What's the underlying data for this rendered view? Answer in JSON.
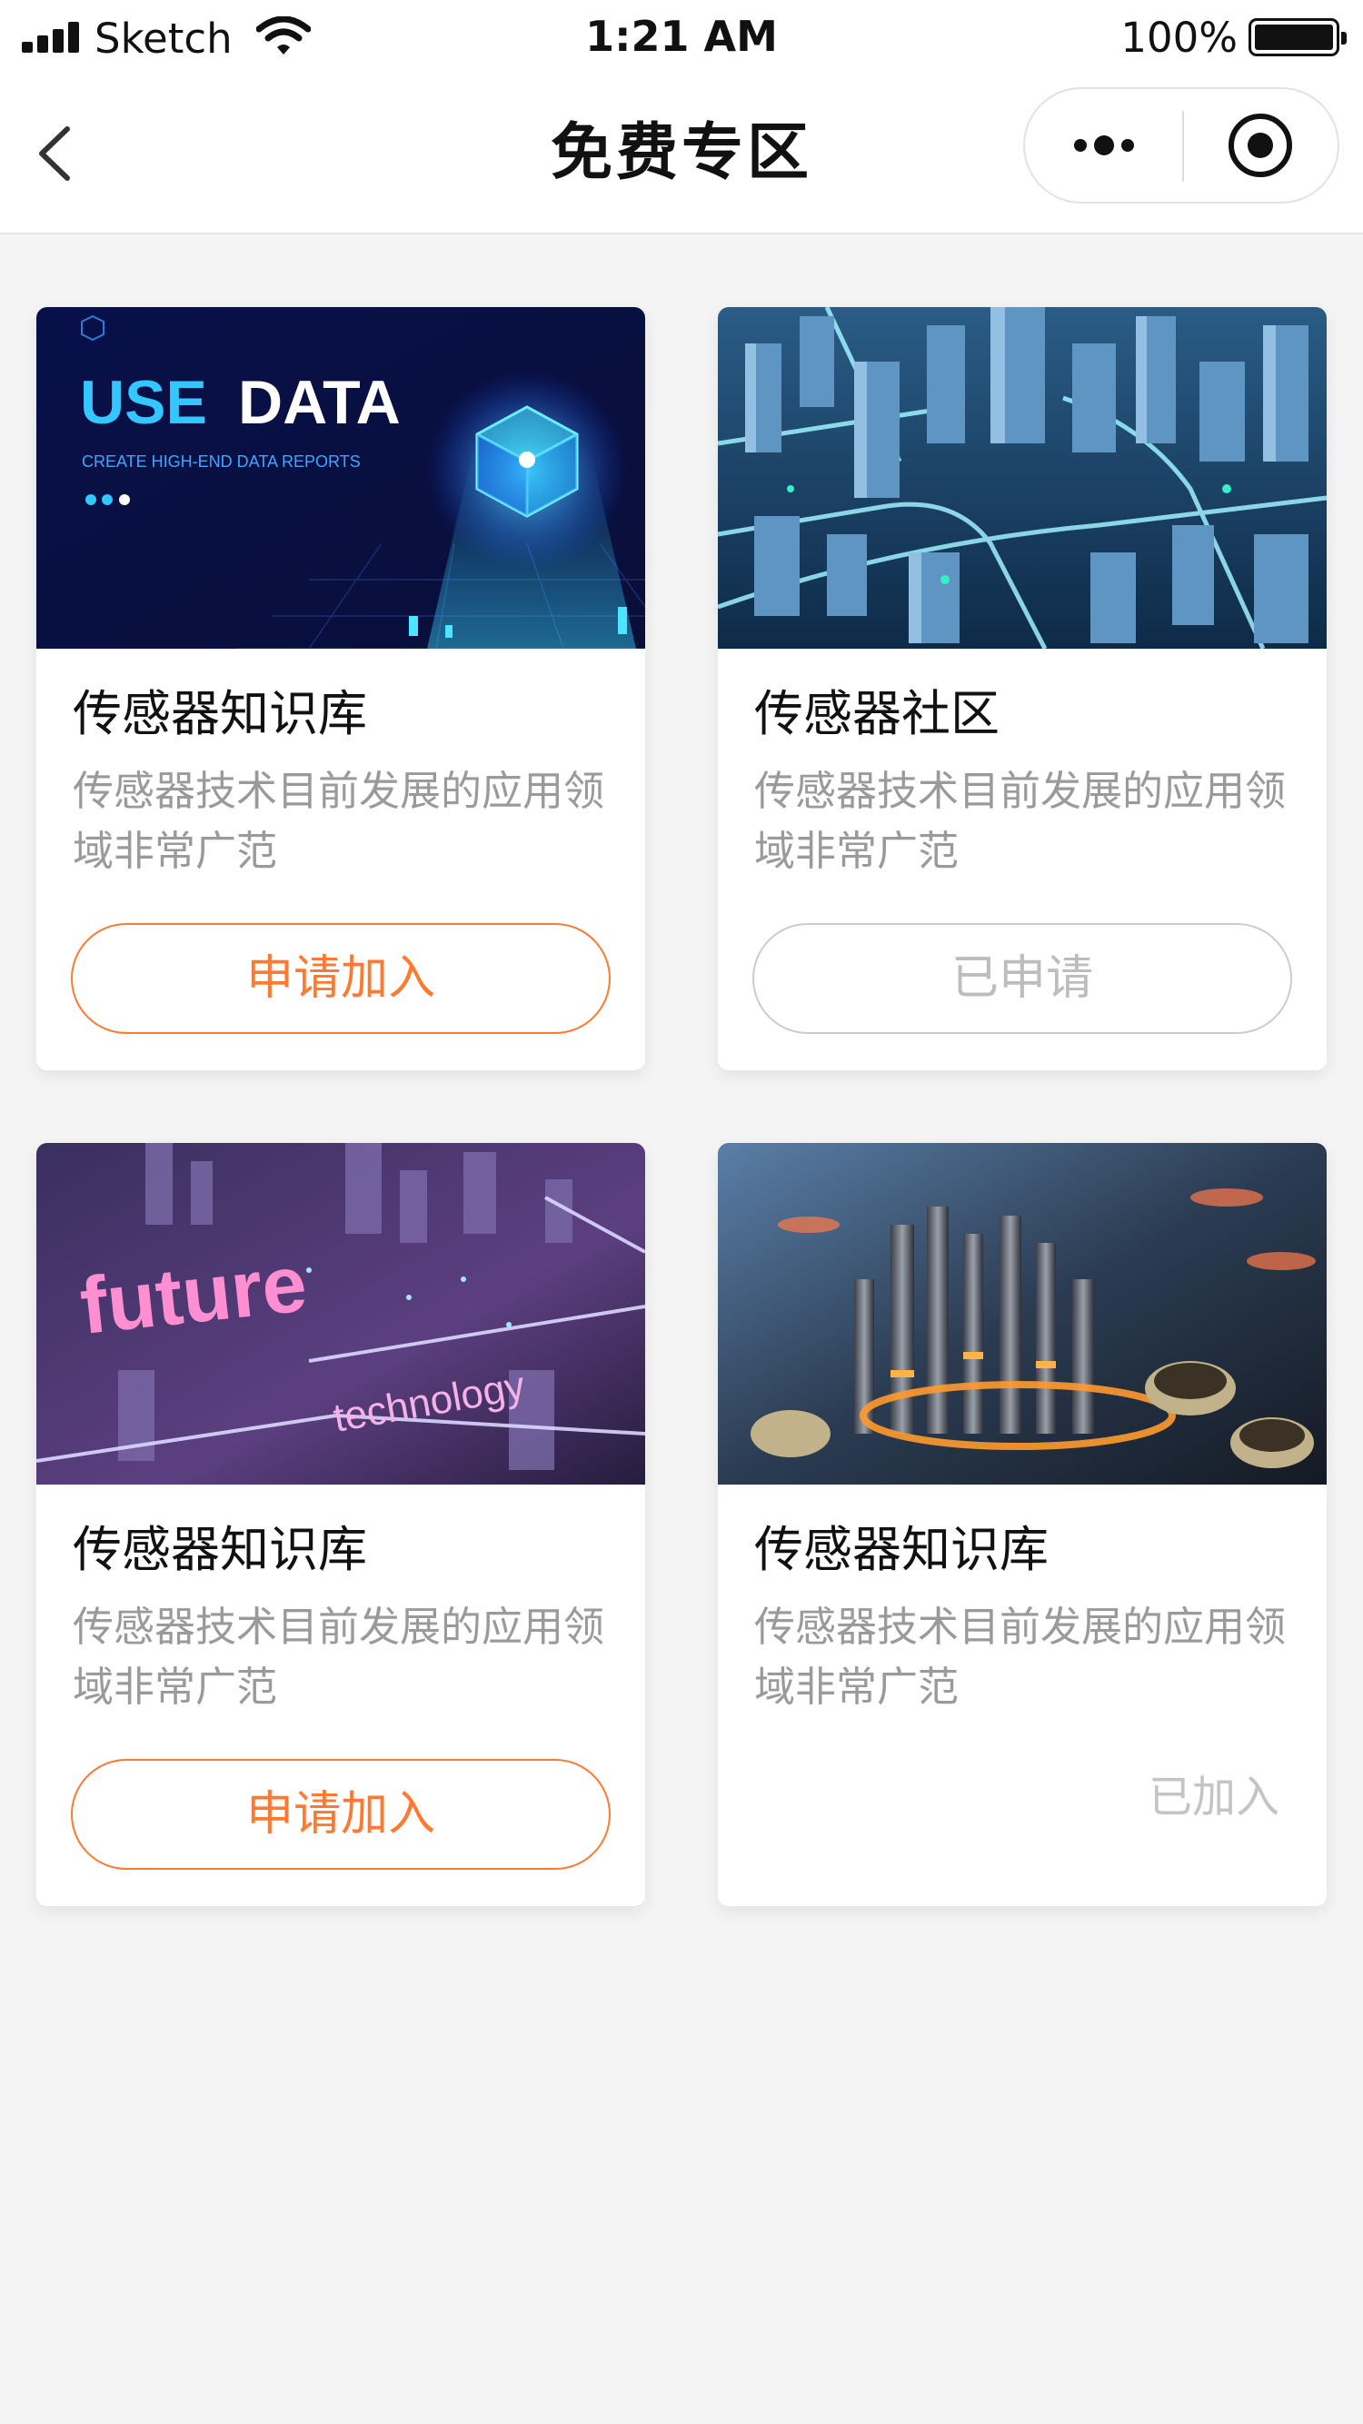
{
  "status_bar": {
    "carrier": "Sketch",
    "time": "1:21 AM",
    "battery": "100%",
    "battery_level": 1.0
  },
  "nav": {
    "title": "免费专区",
    "icons": [
      "back-arrow-icon",
      "more-dots-icon",
      "close-target-icon"
    ]
  },
  "colors": {
    "accent": "#ff7a30",
    "muted": "#bdbdbd",
    "background": "#f4f4f4"
  },
  "cards": [
    {
      "image": "use-data-banner",
      "image_text": {
        "headline_a": "USE",
        "headline_b": "DATA",
        "sub": "CREATE HIGH-END DATA REPORTS"
      },
      "title": "传感器知识库",
      "desc": "传感器技术目前发展的应用领域非常广范",
      "action_label": "申请加入",
      "action_state": "apply"
    },
    {
      "image": "blue-city-banner",
      "title": "传感器社区",
      "desc": "传感器技术目前发展的应用领域非常广范",
      "action_label": "已申请",
      "action_state": "applied"
    },
    {
      "image": "future-technology-banner",
      "image_text": {
        "word_a": "future",
        "word_b": "technology"
      },
      "title": "传感器知识库",
      "desc": "传感器技术目前发展的应用领域非常广范",
      "action_label": "申请加入",
      "action_state": "apply"
    },
    {
      "image": "circuit-chips-banner",
      "title": "传感器知识库",
      "desc": "传感器技术目前发展的应用领域非常广范",
      "action_label": "已加入",
      "action_state": "joined"
    }
  ]
}
